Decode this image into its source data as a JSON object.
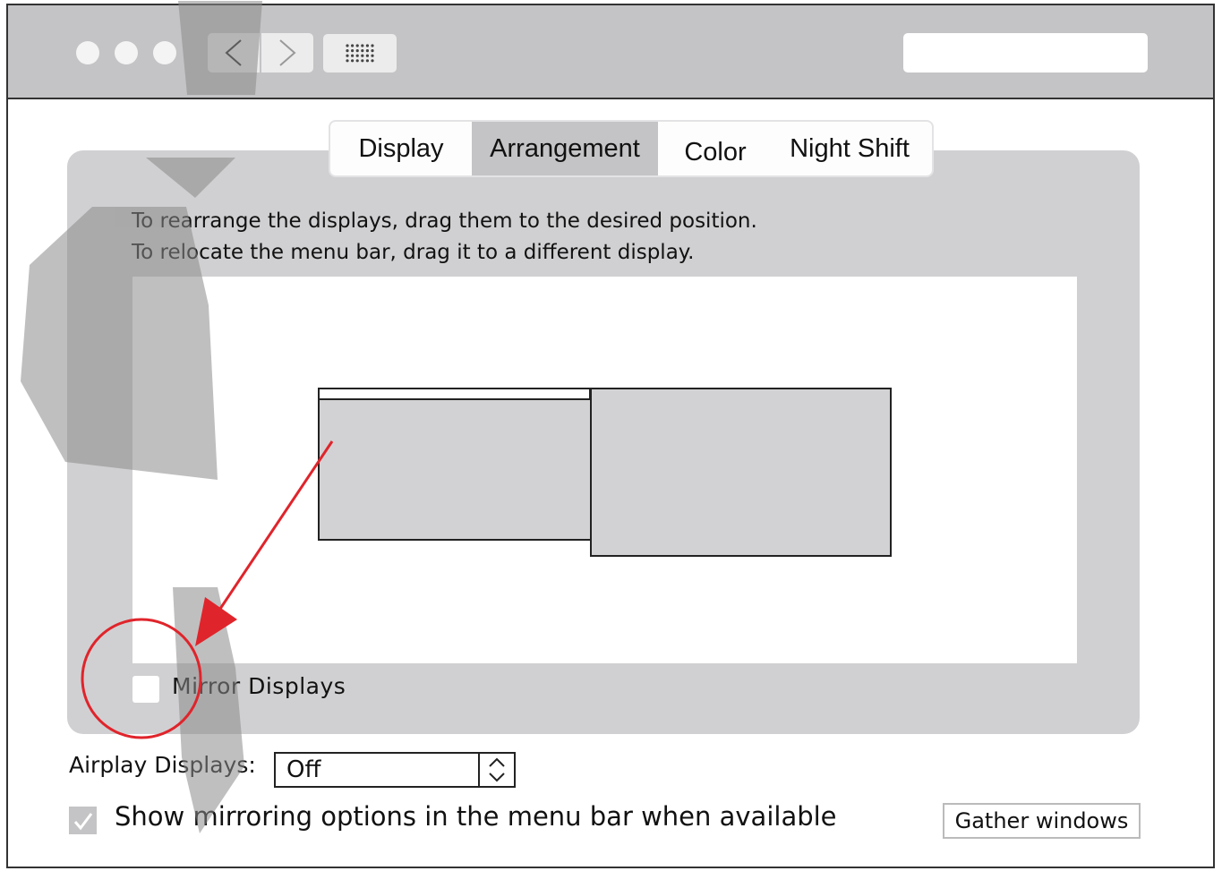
{
  "window": {
    "back_icon": "chevron-left-icon",
    "forward_icon": "chevron-right-icon",
    "grid_icon": "grid-icon",
    "search_placeholder": ""
  },
  "tabs": [
    {
      "label": "Display",
      "active": false
    },
    {
      "label": "Arrangement",
      "active": true
    },
    {
      "label": "Color",
      "active": false
    },
    {
      "label": "Night Shift",
      "active": false
    }
  ],
  "instructions": {
    "line1": "To rearrange the displays, drag them to the desired position.",
    "line2": "To relocate the menu bar, drag it to a different display."
  },
  "mirror": {
    "label": "Mirror Displays",
    "checked": false
  },
  "airplay": {
    "label": "Airplay Displays:",
    "value": "Off"
  },
  "show_mirroring": {
    "label": "Show mirroring options in the menu bar when available",
    "checked": true
  },
  "gather_button": "Gather windows",
  "colors": {
    "titlebar": "#c4c4c6",
    "panel": "#d0d0d2",
    "monitor": "#d2d2d4",
    "annotation": "#e0242b"
  }
}
